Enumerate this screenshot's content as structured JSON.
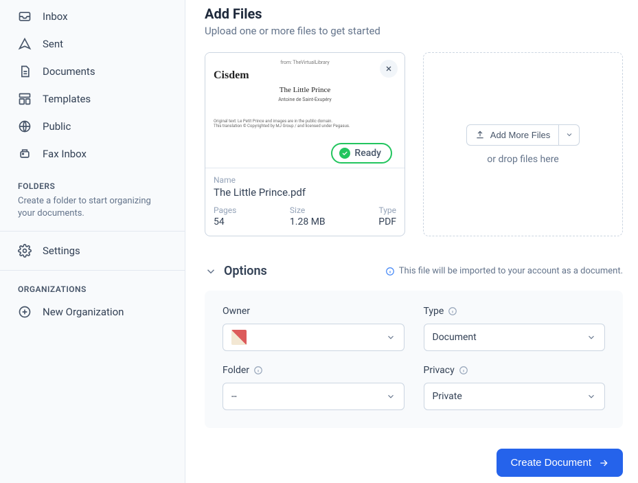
{
  "sidebar": {
    "nav": [
      {
        "label": "Inbox",
        "icon": "inbox-icon"
      },
      {
        "label": "Sent",
        "icon": "sent-icon"
      },
      {
        "label": "Documents",
        "icon": "documents-icon"
      },
      {
        "label": "Templates",
        "icon": "templates-icon"
      },
      {
        "label": "Public",
        "icon": "public-icon"
      },
      {
        "label": "Fax Inbox",
        "icon": "fax-icon"
      }
    ],
    "folders_head": "FOLDERS",
    "folders_sub": "Create a folder to start organizing your documents.",
    "settings_label": "Settings",
    "orgs_head": "ORGANIZATIONS",
    "new_org_label": "New Organization"
  },
  "header": {
    "title": "Add Files",
    "subtitle": "Upload one or more files to get started"
  },
  "file": {
    "ready_label": "Ready",
    "name_label": "Name",
    "name": "The Little Prince.pdf",
    "pages_label": "Pages",
    "pages": "54",
    "size_label": "Size",
    "size": "1.28 MB",
    "type_label": "Type",
    "type": "PDF",
    "thumb_brand": "Cisdem",
    "thumb_topline": "from: TheVirtualLibrary",
    "thumb_title": "The Little Prince",
    "thumb_author": "Antoine de Saint-Exupéry"
  },
  "dropzone": {
    "add_more": "Add More Files",
    "drop_text": "or drop files here"
  },
  "options": {
    "title": "Options",
    "info": "This file will be imported to your account as a document.",
    "owner_label": "Owner",
    "type_label": "Type",
    "type_value": "Document",
    "folder_label": "Folder",
    "folder_value": "--",
    "privacy_label": "Privacy",
    "privacy_value": "Private"
  },
  "actions": {
    "create": "Create Document"
  }
}
